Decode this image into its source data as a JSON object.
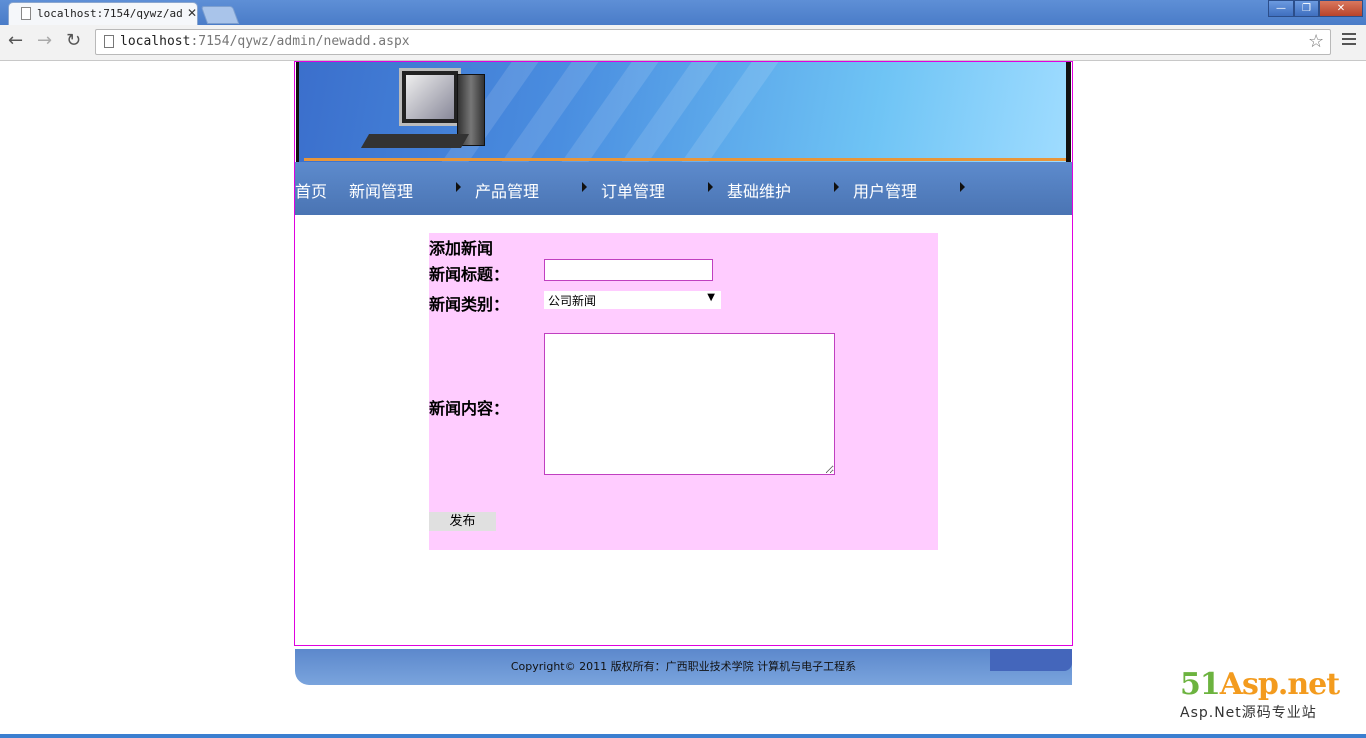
{
  "browser": {
    "tab_title": "localhost:7154/qywz/adm",
    "tab_close": "✕",
    "url_host": "localhost",
    "url_rest": ":7154/qywz/admin/newadd.aspx",
    "window_controls": [
      "—",
      "❐",
      "✕"
    ]
  },
  "nav": {
    "items": [
      "首页",
      "新闻管理",
      "产品管理",
      "订单管理",
      "基础维护",
      "用户管理"
    ]
  },
  "form": {
    "heading": "添加新闻",
    "title_label": "新闻标题：",
    "title_value": "",
    "category_label": "新闻类别：",
    "category_value": "公司新闻",
    "content_label": "新闻内容：",
    "content_value": "",
    "submit_label": "发布"
  },
  "footer": {
    "copyright": "Copyright© 2011 版权所有：广西职业技术学院 计算机与电子工程系"
  },
  "watermark": {
    "brand_five": "51",
    "brand_rest": "Asp.net",
    "tagline": "Asp.Net源码专业站"
  },
  "colors": {
    "form_bg": "#ffccff",
    "frame_border": "#e000e0",
    "nav_bg": "#4a74b3",
    "brand_orange": "#f39b1e",
    "brand_green": "#6cb33f"
  }
}
